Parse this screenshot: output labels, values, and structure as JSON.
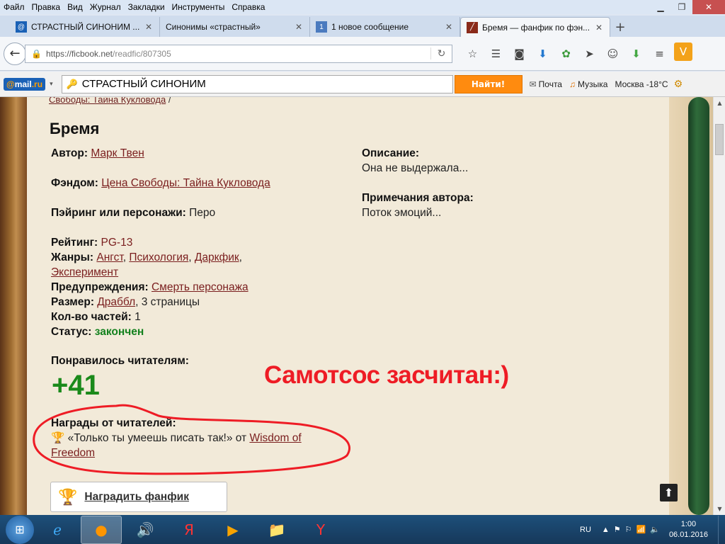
{
  "menubar": {
    "items": [
      "Файл",
      "Правка",
      "Вид",
      "Журнал",
      "Закладки",
      "Инструменты",
      "Справка"
    ]
  },
  "tabs": [
    {
      "title": "СТРАСТНЫЙ СИНОНИМ ...",
      "icon_color": "#1a61b6",
      "icon": "mail-icon"
    },
    {
      "title": "Синонимы «страстный»",
      "icon_color": "",
      "icon": ""
    },
    {
      "title": "1 новое сообщение",
      "icon_color": "#4b7bbf",
      "icon": "vk-icon",
      "icon_text": "1"
    },
    {
      "title": "Бремя — фанфик по фэн...",
      "icon_color": "#8a2a1a",
      "icon": "ficbook-icon",
      "active": true
    }
  ],
  "navbar": {
    "url_host": "https://ficbook.net",
    "url_path": "/readfic/807305"
  },
  "mailbar": {
    "logo_at": "@",
    "logo_mail": "mail",
    "logo_ru": ".ru",
    "query": "СТРАСТНЫЙ СИНОНИМ",
    "find_button": "Найти!",
    "mail_link": "Почта",
    "music_link": "Музыка",
    "weather": "Москва -18°C"
  },
  "page": {
    "breadcrumb_link": "Свободы: Тайна Кукловода",
    "breadcrumb_sep": "/",
    "title": "Бремя",
    "author_label": "Автор:",
    "author": "Марк Твен",
    "fandom_label": "Фэндом:",
    "fandom": "Цена Свободы: Тайна Кукловода",
    "pairing_label": "Пэйринг или персонажи:",
    "pairing": "Перо",
    "rating_label": "Рейтинг:",
    "rating": "PG-13",
    "genres_label": "Жанры:",
    "genres": [
      "Ангст",
      "Психология",
      "Даркфик",
      "Эксперимент"
    ],
    "warnings_label": "Предупреждения:",
    "warning": "Смерть персонажа",
    "size_label": "Размер:",
    "size_link": "Драббл",
    "size_rest": ", 3 страницы",
    "parts_label": "Кол-во частей:",
    "parts": "1",
    "status_label": "Статус:",
    "status": "закончен",
    "description_label": "Описание:",
    "description": "Она не выдержала...",
    "notes_label": "Примечания автора:",
    "notes": "Поток эмоций...",
    "likes_label": "Понравилось читателям:",
    "likes": "+41",
    "awards_label": "Награды от читателей:",
    "award_text": "«Только ты умеешь писать так!» от",
    "award_from_1": "Wisdom of",
    "award_from_2": "Freedom",
    "award_button": "Наградить фанфик",
    "annotation": "Самотсос засчитан:)"
  },
  "taskbar": {
    "lang": "RU",
    "time": "1:00",
    "date": "06.01.2016"
  },
  "colors": {
    "link": "#7a1e1e",
    "status_green": "#14811e",
    "annotation_red": "#ee1c25",
    "find_orange": "#ff8b0f"
  }
}
